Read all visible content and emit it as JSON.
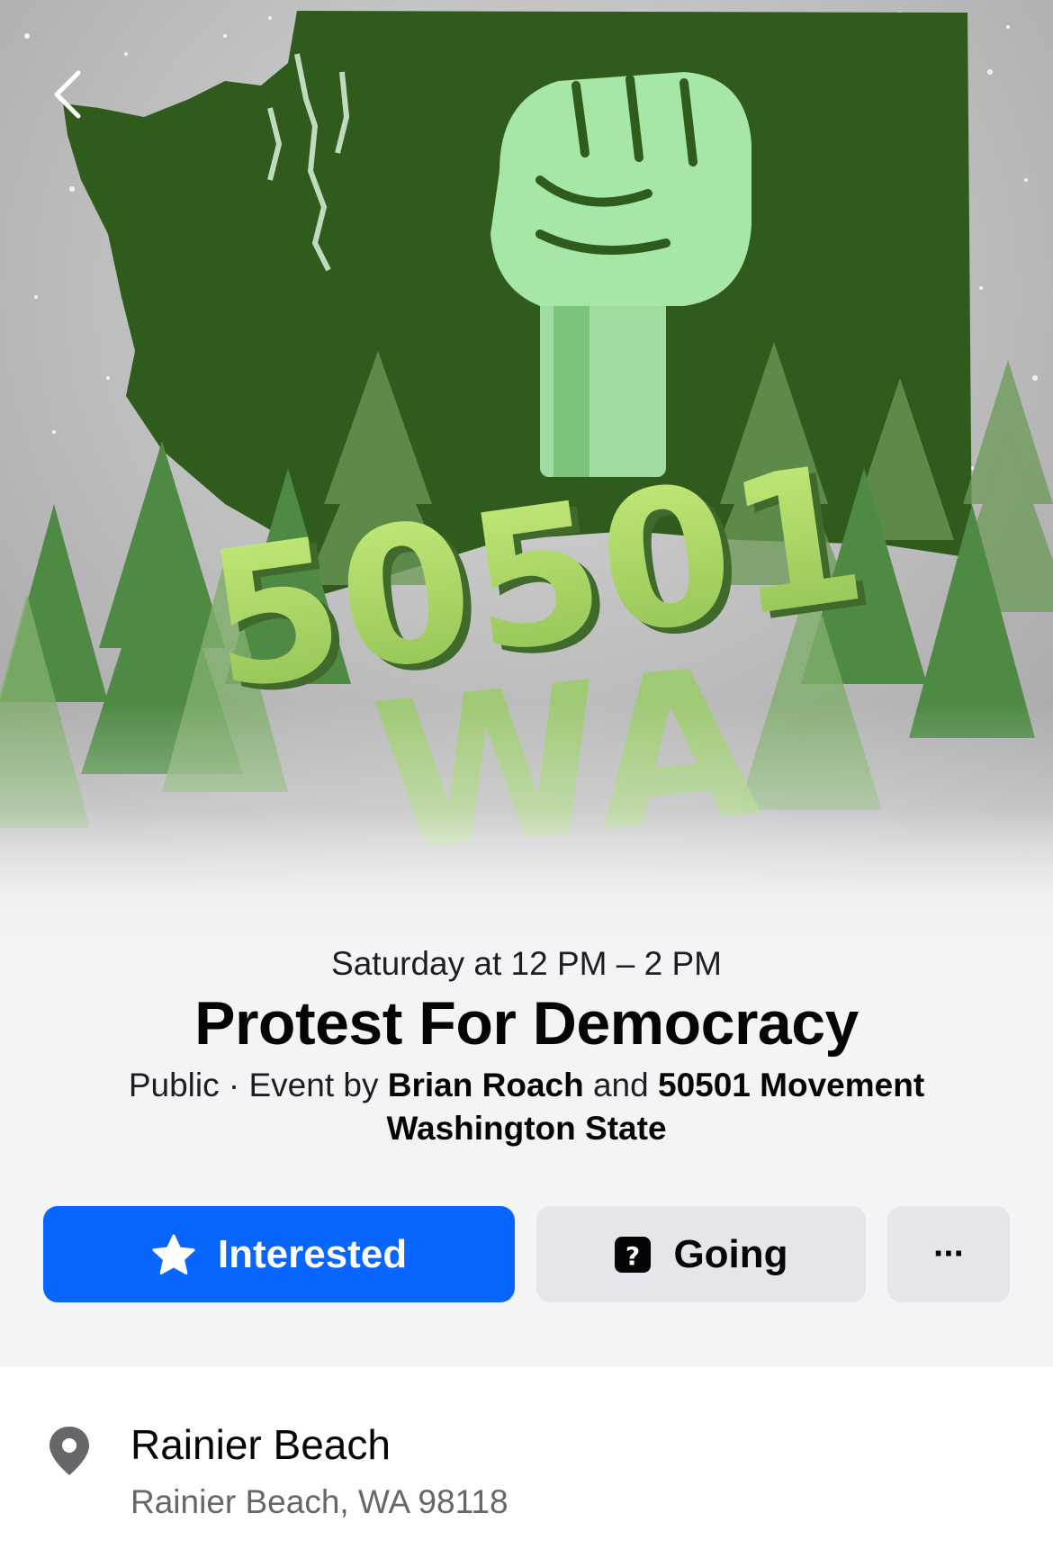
{
  "cover": {
    "number_text": "50501",
    "state_text": "WA"
  },
  "event": {
    "date_time": "Saturday at 12 PM – 2 PM",
    "title": "Protest For Democracy",
    "privacy": "Public",
    "separator": " · ",
    "hosted_prefix": "Event by ",
    "host_1": "Brian Roach",
    "host_joiner": " and ",
    "host_2": "50501 Movement Washington State"
  },
  "actions": {
    "interested_label": "Interested",
    "going_label": "Going",
    "more_label": "···"
  },
  "location": {
    "name": "Rainier Beach",
    "address": "Rainier Beach, WA 98118"
  },
  "colors": {
    "primary": "#0866ff",
    "secondary_button": "#e4e6eb",
    "header_bg": "#f3f4f6",
    "map_green": "#2d5a1a",
    "fist_green": "#a6e6a6",
    "text_lime": "#a8d66a"
  },
  "icons": {
    "back": "chevron-left-icon",
    "interested": "star-icon",
    "going": "question-mark-calendar-icon",
    "more": "ellipsis-icon",
    "location": "map-pin-icon"
  }
}
